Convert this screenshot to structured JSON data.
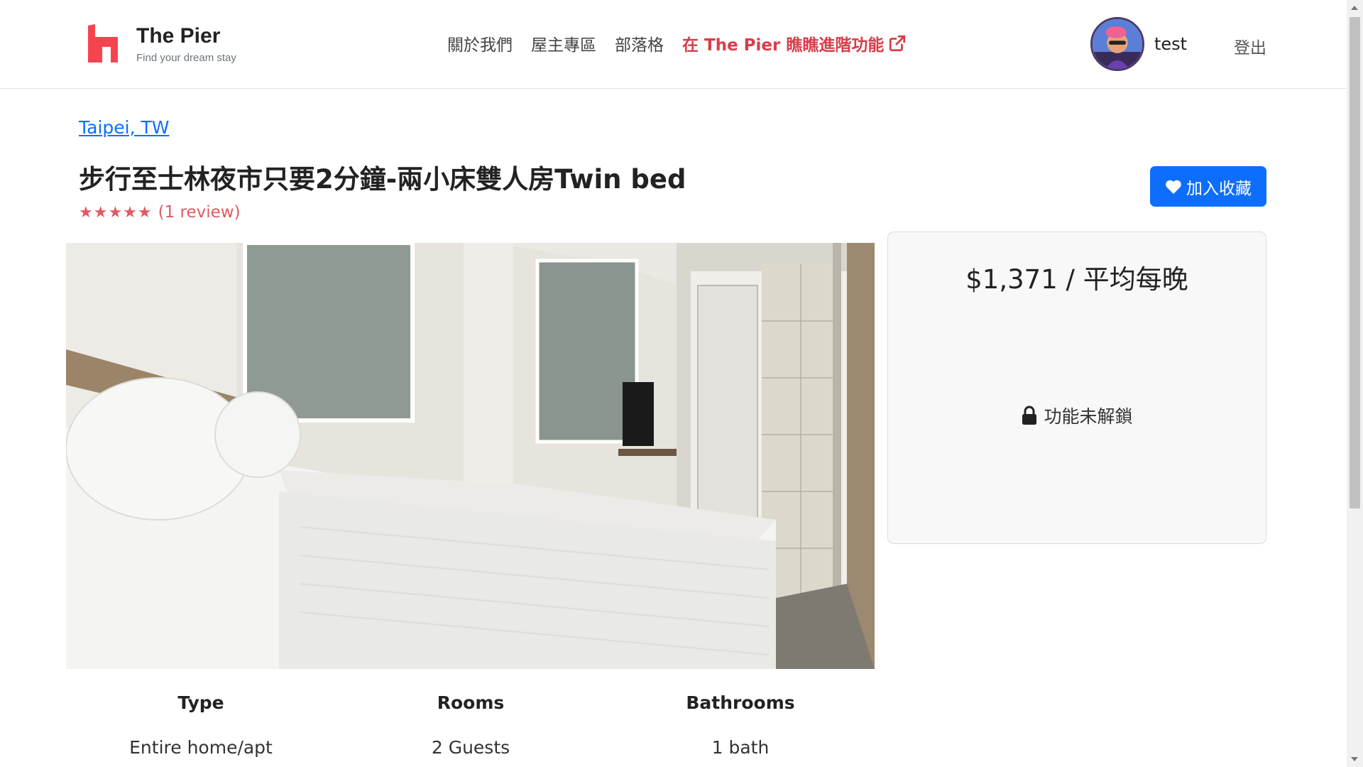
{
  "brand": {
    "title": "The Pier",
    "tagline": "Find your dream stay",
    "color": "#f5444f"
  },
  "nav": {
    "items": [
      {
        "label": "關於我們"
      },
      {
        "label": "屋主專區"
      },
      {
        "label": "部落格"
      }
    ],
    "feature_link": "在 The Pier 瞧瞧進階功能",
    "feature_icon": "external-link-icon"
  },
  "user": {
    "name": "test",
    "logout_label": "登出",
    "avatar_icon": "user-avatar"
  },
  "listing": {
    "location": "Taipei, TW",
    "title": "步行至士林夜市只要2分鐘-兩小床雙人房Twin bed",
    "stars": "★★★★★",
    "rating_value": 5,
    "review_text": "(1 review)",
    "favorite_label": "加入收藏",
    "favorite_icon": "heart-icon",
    "photo_icon": "room-photo"
  },
  "price_card": {
    "price": "$1,371 / 平均每晚",
    "locked_label": "功能未解鎖",
    "lock_icon": "lock-icon"
  },
  "stats": [
    {
      "label": "Type",
      "value": "Entire home/apt"
    },
    {
      "label": "Rooms",
      "value": "2 Guests"
    },
    {
      "label": "Bathrooms",
      "value": "1 bath"
    }
  ],
  "colors": {
    "accent": "#0d6efd",
    "highlight": "#d63e4a",
    "rating": "#e05a62"
  }
}
